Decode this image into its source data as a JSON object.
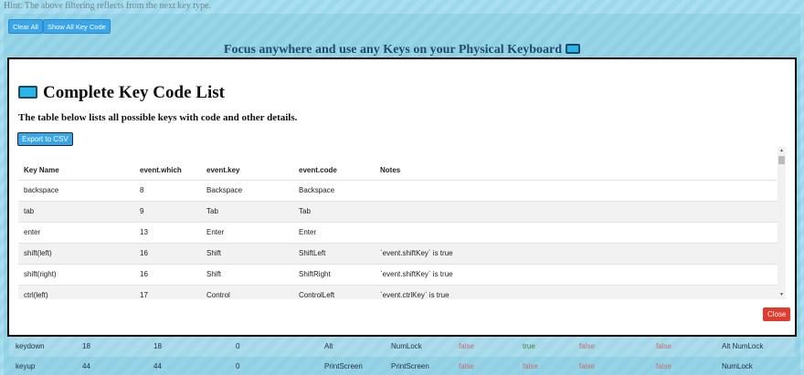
{
  "background": {
    "hint": "Hint: The above filtering reflects from the next key type.",
    "clear_all_label": "Clear All",
    "show_all_label": "Show All Key Code",
    "heading": "Focus anywhere and use any Keys on your Physical Keyboard",
    "rows": [
      [
        "keydown",
        "18",
        "18",
        "0",
        "Alt",
        "NumLock",
        "false",
        "true",
        "false",
        "false",
        "Alt NumLock"
      ],
      [
        "keyup",
        "44",
        "44",
        "0",
        "PrintScreen",
        "PrintScreen",
        "false",
        "false",
        "false",
        "false",
        "NumLock"
      ]
    ]
  },
  "modal": {
    "title": "Complete Key Code List",
    "description": "The table below lists all possible keys with code and other details.",
    "export_label": "Export to CSV",
    "close_label": "Close",
    "columns": [
      "Key Name",
      "event.which",
      "event.key",
      "event.code",
      "Notes"
    ],
    "rows": [
      [
        "backspace",
        "8",
        "Backspace",
        "Backspace",
        ""
      ],
      [
        "tab",
        "9",
        "Tab",
        "Tab",
        ""
      ],
      [
        "enter",
        "13",
        "Enter",
        "Enter",
        ""
      ],
      [
        "shift(left)",
        "16",
        "Shift",
        "ShiftLeft",
        "`event.shiftKey` is true"
      ],
      [
        "shift(right)",
        "16",
        "Shift",
        "ShiftRight",
        "`event.shiftKey` is true"
      ],
      [
        "ctrl(left)",
        "17",
        "Control",
        "ControlLeft",
        "`event.ctrlKey` is true"
      ]
    ]
  },
  "colors": {
    "accent": "#3aa6e8",
    "danger": "#e23b2e"
  }
}
